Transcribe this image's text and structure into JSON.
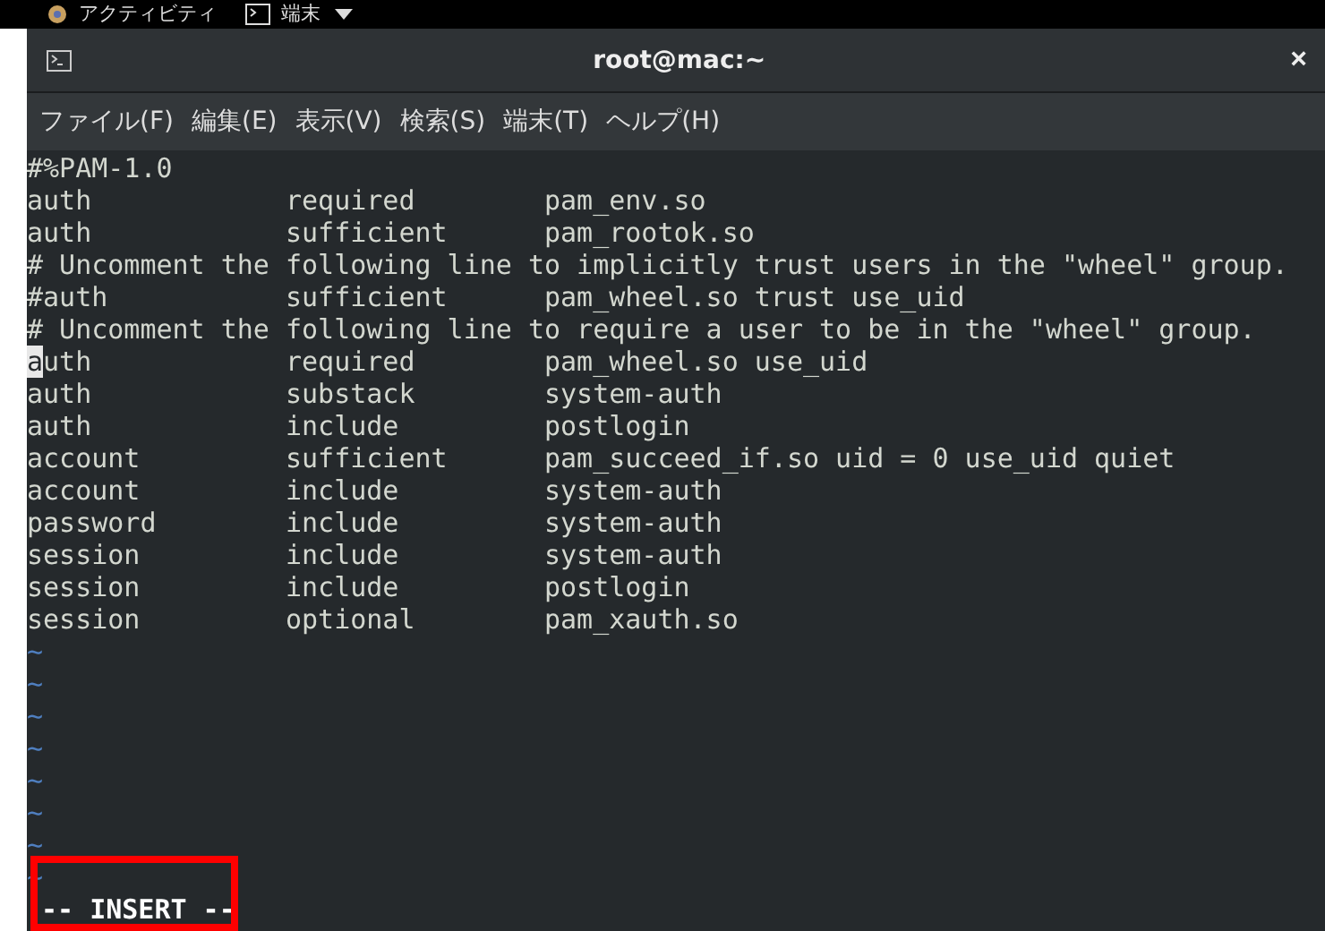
{
  "top_bar": {
    "activities": "アクティビティ",
    "app_menu": "端末"
  },
  "window": {
    "title": "root@mac:~",
    "close": "×"
  },
  "menu": [
    "ファイル(F)",
    "編集(E)",
    "表示(V)",
    "検索(S)",
    "端末(T)",
    "ヘルプ(H)"
  ],
  "terminal": {
    "lines": [
      {
        "text": "#%PAM-1.0"
      },
      {
        "text": "auth            required        pam_env.so"
      },
      {
        "text": "auth            sufficient      pam_rootok.so"
      },
      {
        "text": "# Uncomment the following line to implicitly trust users in the \"wheel\" group."
      },
      {
        "text": "#auth           sufficient      pam_wheel.so trust use_uid"
      },
      {
        "text": "# Uncomment the following line to require a user to be in the \"wheel\" group."
      },
      {
        "cursor": "a",
        "text": "uth            required        pam_wheel.so use_uid"
      },
      {
        "text": "auth            substack        system-auth"
      },
      {
        "text": "auth            include         postlogin"
      },
      {
        "text": "account         sufficient      pam_succeed_if.so uid = 0 use_uid quiet"
      },
      {
        "text": "account         include         system-auth"
      },
      {
        "text": "password        include         system-auth"
      },
      {
        "text": "session         include         system-auth"
      },
      {
        "text": "session         include         postlogin"
      },
      {
        "text": "session         optional        pam_xauth.so"
      }
    ],
    "empty_lines": [
      "~",
      "~",
      "~",
      "~",
      "~",
      "~",
      "~",
      "~"
    ],
    "mode": "-- INSERT --"
  },
  "annotation": {
    "kind": "highlight"
  }
}
